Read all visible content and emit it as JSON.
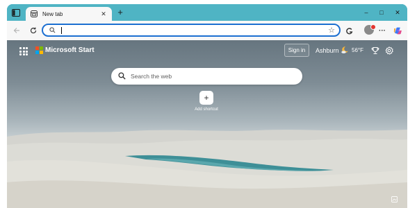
{
  "tab": {
    "title": "New tab",
    "close_glyph": "✕"
  },
  "new_tab_glyph": "+",
  "window_controls": {
    "minimize": "–",
    "maximize": "□",
    "close": "✕"
  },
  "address_bar": {
    "value": "",
    "placeholder": ""
  },
  "header": {
    "brand": "Microsoft Start",
    "sign_in": "Sign in"
  },
  "weather": {
    "city": "Ashburn",
    "temp": "56°F",
    "icon": "moon-cloud-icon"
  },
  "search": {
    "placeholder": "Search the web"
  },
  "shortcut": {
    "glyph": "+",
    "label": "Add shortcut"
  },
  "colors": {
    "frame": "#4fb4c4",
    "address_focus": "#1c6fd1",
    "ms_logo": [
      "#f25022",
      "#7fba00",
      "#00a4ef",
      "#ffb900"
    ],
    "water": "#3e8f97"
  }
}
